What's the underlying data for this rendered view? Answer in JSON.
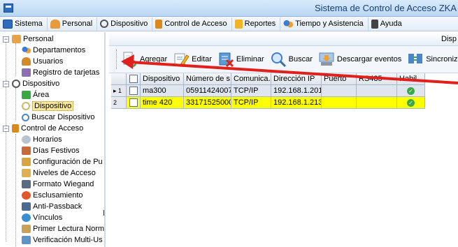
{
  "window": {
    "title": "Sistema de Control de Acceso ZKA"
  },
  "menu": [
    {
      "label": "Sistema",
      "icon": "monitor-icon",
      "color": "#2e6cc0"
    },
    {
      "label": "Personal",
      "icon": "person-icon",
      "color": "#e89a3c"
    },
    {
      "label": "Dispositivo",
      "icon": "gear-icon",
      "color": "#555555"
    },
    {
      "label": "Control de Acceso",
      "icon": "book-icon",
      "color": "#d98a1f"
    },
    {
      "label": "Reportes",
      "icon": "report-icon",
      "color": "#f0b429"
    },
    {
      "label": "Tiempo y Asistencia",
      "icon": "people-icon",
      "color": "#3b7dd8"
    },
    {
      "label": "Ayuda",
      "icon": "help-book-icon",
      "color": "#444444"
    }
  ],
  "tree": {
    "groups": [
      {
        "label": "Personal",
        "items": [
          "Departamentos",
          "Usuarios",
          "Registro de tarjetas"
        ]
      },
      {
        "label": "Dispositivo",
        "items": [
          "Área",
          "Dispositivo",
          "Buscar Dispositivo"
        ]
      },
      {
        "label": "Control de Acceso",
        "items": [
          "Horarios",
          "Días Festivos",
          "Configuración de Pu",
          "Niveles de Acceso",
          "Formato Wiegand",
          "Esclusamiento",
          "Anti-Passback",
          "Vínculos",
          "Primer Lectura Norm",
          "Verificación Multi-Us"
        ]
      }
    ],
    "selected": "Dispositivo"
  },
  "main": {
    "panel_title": "Disp",
    "toolbar": {
      "add": "Agregar",
      "edit": "Editar",
      "delete": "Eliminar",
      "search": "Buscar",
      "download": "Descargar eventos",
      "sync": "Sincronizar"
    },
    "grid": {
      "columns": [
        "Dispositivo",
        "Número de s...",
        "Comunica...",
        "Dirección IP",
        "Puerto",
        "RS485",
        "Habil..."
      ],
      "rows": [
        {
          "num": "1",
          "device": "ma300",
          "serial": "05911424007...",
          "comm": "TCP/IP",
          "ip": "192.168.1.201",
          "port": "",
          "rs485": "",
          "enabled": true
        },
        {
          "num": "2",
          "device": "time 420",
          "serial": "33171525000...",
          "comm": "TCP/IP",
          "ip": "192.168.1.213",
          "port": "",
          "rs485": "",
          "enabled": true
        }
      ]
    }
  },
  "colors": {
    "highlight_row": "#ffff00",
    "selected_row": "#dfe6f0",
    "annotation_arrow": "#e0201c"
  }
}
